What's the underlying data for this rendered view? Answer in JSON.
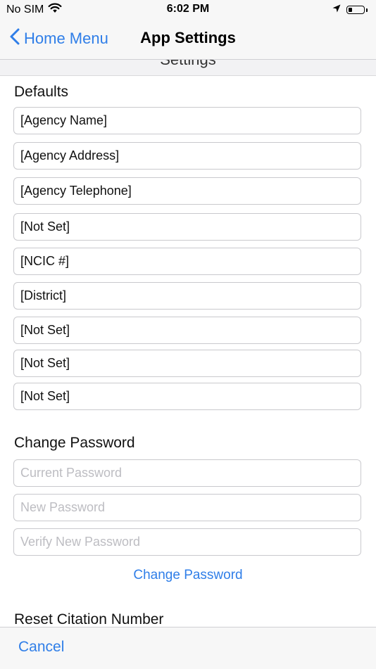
{
  "status_bar": {
    "carrier": "No SIM",
    "time": "6:02 PM",
    "icons": [
      "wifi-icon",
      "location-icon",
      "battery-icon"
    ],
    "battery_level": 0.25
  },
  "nav": {
    "back_label": "Home Menu",
    "title": "App Settings"
  },
  "peek_header": "Settings",
  "defaults": {
    "title": "Defaults",
    "fields": [
      "[Agency Name]",
      "[Agency Address]",
      "[Agency Telephone]",
      "[Not Set]",
      "[NCIC #]",
      "[District]",
      "[Not Set]",
      "[Not Set]",
      "[Not Set]"
    ]
  },
  "change_password": {
    "title": "Change Password",
    "current_placeholder": "Current Password",
    "new_placeholder": "New Password",
    "verify_placeholder": "Verify New Password",
    "button_label": "Change Password"
  },
  "reset_citation": {
    "title": "Reset Citation Number"
  },
  "toolbar": {
    "cancel_label": "Cancel"
  },
  "colors": {
    "accent": "#2f7ee8",
    "bar_background": "#f7f7f7",
    "field_border": "#c9c9cd",
    "placeholder": "#bdbdc2"
  }
}
